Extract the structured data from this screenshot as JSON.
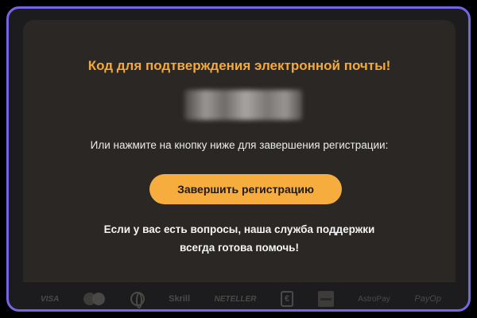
{
  "email": {
    "title": "Код для подтверждения электронной почты!",
    "instruction": "Или нажмите на кнопку ниже для завершения регистрации:",
    "button_label": "Завершить регистрацию",
    "support_line1": "Если у вас есть вопросы, наша служба поддержки",
    "support_line2": "всегда готова помочь!"
  },
  "payments": {
    "visa": "VISA",
    "skrill": "Skrill",
    "neteller": "NETELLER",
    "ecash": "€",
    "astropay": "AstroPay",
    "payop": "PayOp"
  },
  "colors": {
    "accent": "#f7ac3e",
    "title": "#f3a93c",
    "card_bg": "#2a2724",
    "frame_border": "#7466e0"
  }
}
